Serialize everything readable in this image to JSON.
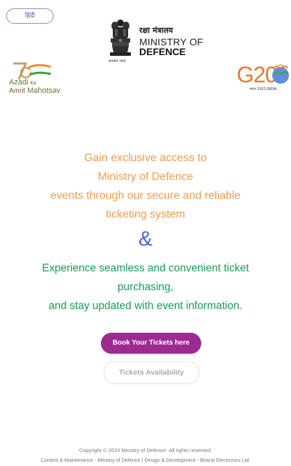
{
  "header": {
    "language_toggle": "हिंदी",
    "ministry_logo": {
      "hindi": "रक्षा मंत्रालय",
      "line1": "MINISTRY OF",
      "line2": "DEFENCE",
      "motto": "सत्यमेव जयते"
    },
    "azadi_logo": {
      "line1": "Azadi",
      "line1_small": "Ka",
      "line2": "Amrit",
      "line2_big": "Mahotsav"
    },
    "g20_logo": {
      "letters": "G20",
      "sub": "भारत 2023 INDIA"
    }
  },
  "hero": {
    "orange_lines": [
      "Gain exclusive access to",
      "Ministry of Defence",
      "events through our secure and reliable",
      "ticketing system"
    ],
    "ampersand": "&",
    "green_lines": [
      "Experience seamless and convenient ticket",
      "purchasing,",
      "and stay updated with event information."
    ]
  },
  "actions": {
    "book_label": "Book Your Tickets here",
    "availability_label": "Tickets Availability"
  },
  "footer": {
    "copyright": "Copyright © 2023 Ministry of Defence. All rights reserved.",
    "credits": "Content & Maintenance - Ministry of Defence | Design & Development - Bharat Electronics Ltd."
  },
  "colors": {
    "orange_text": "#f39a4c",
    "green_text": "#179d55",
    "ampersand": "#4a63d8",
    "book_button": "#9c2a8f"
  }
}
